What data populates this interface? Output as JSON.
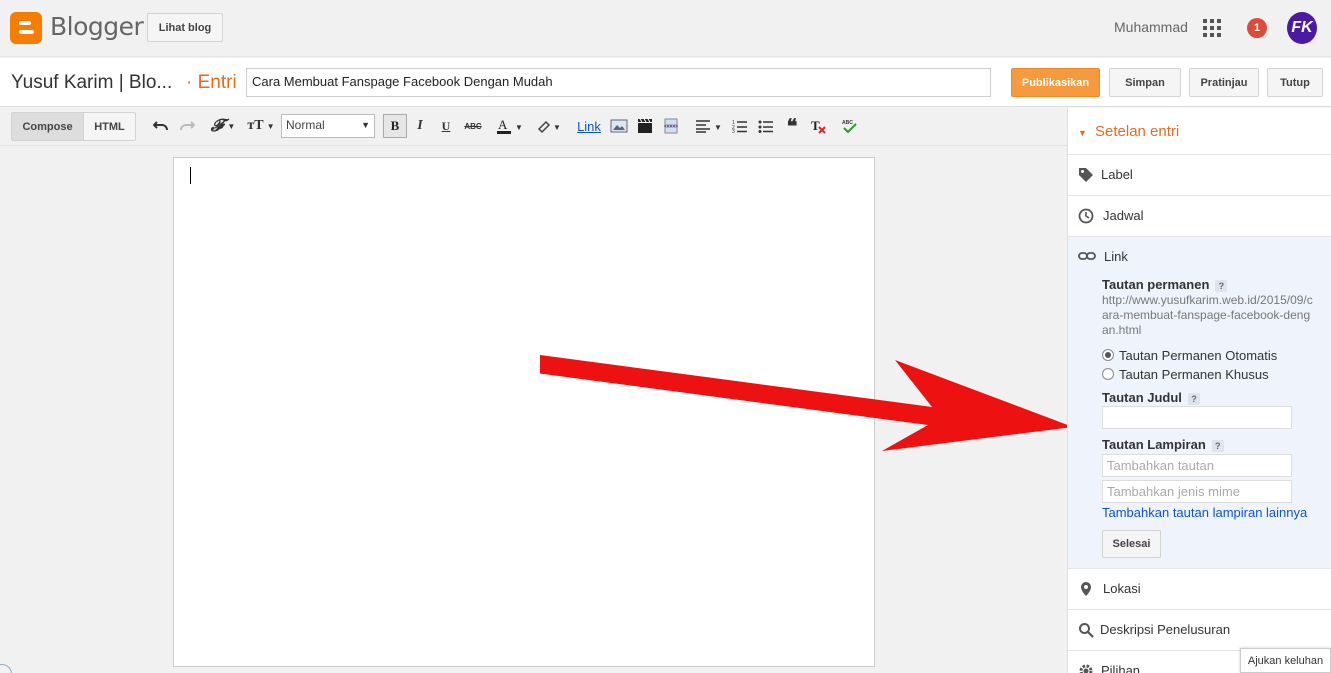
{
  "topbar": {
    "logo_text": "Blogger",
    "view_blog": "Lihat blog",
    "user_name": "Muhammad",
    "notification_count": "1",
    "avatar_initials": "FK"
  },
  "post": {
    "blog_name": "Yusuf Karim | Blo...",
    "breadcrumb": "· Entri",
    "title_value": "Cara Membuat Fanspage Facebook Dengan Mudah"
  },
  "actions": {
    "publish": "Publikasikan",
    "save": "Simpan",
    "preview": "Pratinjau",
    "close": "Tutup"
  },
  "toolbar": {
    "compose": "Compose",
    "html": "HTML",
    "format_value": "Normal",
    "bold": "B",
    "italic": "I",
    "underline": "U",
    "strike": "ABC",
    "link": "Link"
  },
  "sidebar": {
    "header": "Setelan entri",
    "label": "Label",
    "schedule": "Jadwal",
    "link": "Link",
    "permalink_title": "Tautan permanen",
    "permalink_value": "http://www.yusufkarim.web.id/2015/09/cara-membuat-fanspage-facebook-dengan.html",
    "radio_auto": "Tautan Permanen Otomatis",
    "radio_custom": "Tautan Permanen Khusus",
    "title_link": "Tautan Judul",
    "attachment_link": "Tautan Lampiran",
    "attachment_placeholder": "Tambahkan tautan",
    "mime_placeholder": "Tambahkan jenis mime",
    "add_more": "Tambahkan tautan lampiran lainnya",
    "done": "Selesai",
    "location": "Lokasi",
    "search_desc": "Deskripsi Penelusuran",
    "options": "Pilihan",
    "help_mark": "?"
  },
  "feedback": "Ajukan keluhan",
  "colors": {
    "accent": "#e36c21",
    "publish": "#f59a3e",
    "link": "#1155cc",
    "arrow": "#ee1111"
  }
}
